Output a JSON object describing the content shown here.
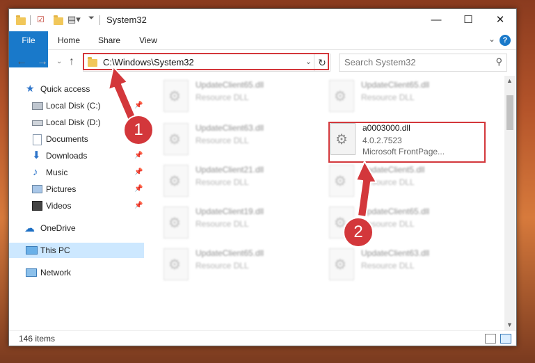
{
  "window": {
    "title": "System32"
  },
  "ribbon": {
    "tabs": [
      "File",
      "Home",
      "Share",
      "View"
    ],
    "help": "?"
  },
  "address": {
    "path": "C:\\Windows\\System32",
    "search_placeholder": "Search System32"
  },
  "sidebar": {
    "items": [
      {
        "label": "Quick access",
        "icon": "star-icon",
        "pinned": false
      },
      {
        "label": "Local Disk (C:)",
        "icon": "drive-icon",
        "pinned": true
      },
      {
        "label": "Local Disk (D:)",
        "icon": "drive-icon",
        "pinned": true
      },
      {
        "label": "Documents",
        "icon": "documents-icon",
        "pinned": true
      },
      {
        "label": "Downloads",
        "icon": "download-icon",
        "pinned": true
      },
      {
        "label": "Music",
        "icon": "music-icon",
        "pinned": true
      },
      {
        "label": "Pictures",
        "icon": "pictures-icon",
        "pinned": true
      },
      {
        "label": "Videos",
        "icon": "videos-icon",
        "pinned": true
      },
      {
        "label": "OneDrive",
        "icon": "cloud-icon",
        "pinned": false
      },
      {
        "label": "This PC",
        "icon": "computer-icon",
        "pinned": false
      },
      {
        "label": "Network",
        "icon": "network-icon",
        "pinned": false
      }
    ]
  },
  "files": [
    {
      "name": "UpdateClient65.dll",
      "type": "Resource DLL"
    },
    {
      "name": "UpdateClient65.dll",
      "type": "Resource DLL"
    },
    {
      "name": "UpdateClient63.dll",
      "type": "Resource DLL"
    },
    {
      "name": "UpdateClient21.dll",
      "type": "Resource DLL"
    },
    {
      "name": "UpdateClient5.dll",
      "type": "Resource DLL"
    },
    {
      "name": "UpdateClient19.dll",
      "type": "Resource DLL"
    },
    {
      "name": "UpdateClient65.dll",
      "type": "Resource DLL"
    },
    {
      "name": "UpdateClient65.dll",
      "type": "Resource DLL"
    },
    {
      "name": "UpdateClient63.dll",
      "type": "Resource DLL"
    }
  ],
  "selected_file": {
    "name": "a0003000.dll",
    "version": "4.0.2.7523",
    "description": "Microsoft FrontPage..."
  },
  "status": {
    "count": "146 items"
  },
  "annotations": {
    "step1": "1",
    "step2": "2",
    "color": "#d3373b"
  }
}
